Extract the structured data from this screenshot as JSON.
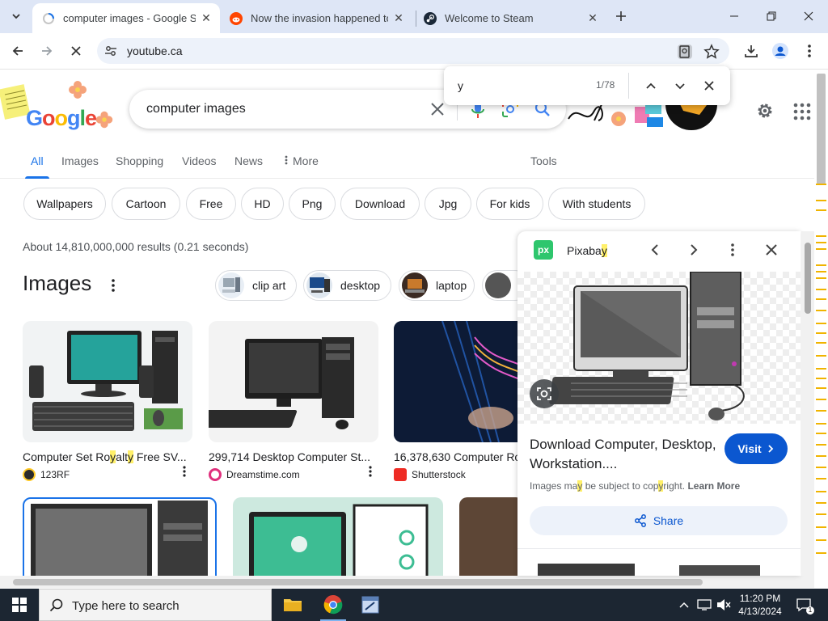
{
  "browser": {
    "tabs": [
      {
        "title": "computer images - Google Sea",
        "active": true
      },
      {
        "title": "Now the invasion happened to",
        "active": false
      },
      {
        "title": "Welcome to Steam",
        "active": false
      }
    ],
    "url": "youtube.ca",
    "find": {
      "query": "y",
      "count": "1/78"
    }
  },
  "google": {
    "logo": "Google",
    "query": "computer images",
    "nav_tabs": [
      "All",
      "Images",
      "Shopping",
      "Videos",
      "News",
      "More",
      "Tools"
    ],
    "chips": [
      "Wallpapers",
      "Cartoon",
      "Free",
      "HD",
      "Png",
      "Download",
      "Jpg",
      "For kids",
      "With students"
    ],
    "result_stats": "About 14,810,000,000 results (0.21 seconds)",
    "images_heading": "Images",
    "related": [
      "clip art",
      "desktop",
      "laptop"
    ],
    "cards": [
      {
        "title_pre": "Computer Set Ro",
        "title_h1": "y",
        "title_mid": "alt",
        "title_h2": "y",
        "title_post": " Free SV...",
        "source": "123RF"
      },
      {
        "title": "299,714 Desktop Computer St...",
        "source": "Dreamstime.com"
      },
      {
        "title": "16,378,630 Computer Ro",
        "source": "Shutterstock"
      }
    ]
  },
  "panel": {
    "site_pre": "Pixaba",
    "site_hl": "y",
    "title": "Download Computer, Desktop, Workstation....",
    "visit": "Visit",
    "notice_a": "Images ma",
    "notice_h1": "y",
    "notice_b": " be subject to cop",
    "notice_h2": "y",
    "notice_c": "right. ",
    "learn_more": "Learn More",
    "share": "Share"
  },
  "taskbar": {
    "search_placeholder": "Type here to search",
    "time": "11:20 PM",
    "date": "4/13/2024"
  },
  "colors": {
    "accent": "#1a73e8",
    "visit_button": "#0b57d0",
    "find_highlight": "#fff06a",
    "taskbar": "#1c2632"
  }
}
